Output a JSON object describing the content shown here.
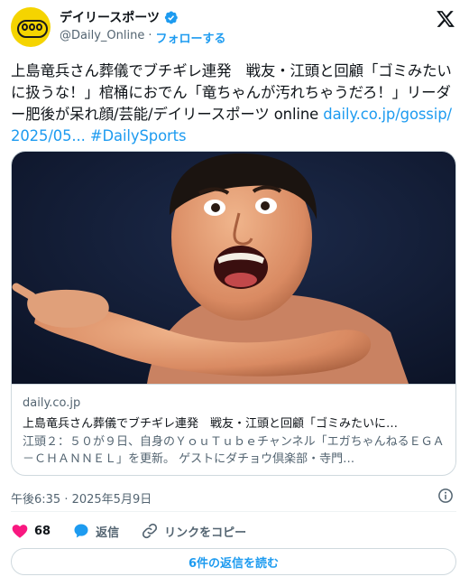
{
  "author": {
    "name": "デイリースポーツ",
    "handle": "@Daily_Online",
    "dot": "·",
    "follow_label": "フォローする",
    "avatar_icon": "daily-sports-logo",
    "verified_icon": "verified-badge-icon",
    "verified_color": "#1d9bf0"
  },
  "tweet": {
    "text": "上島竜兵さん葬儀でブチギレ連発　戦友・江頭と回顧「ゴミみたいに扱うな！」棺桶におでん「竜ちゃんが汚れちゃうだろ！」リーダー肥後が呆れ顔/芸能/デイリースポーツ online ",
    "link": "daily.co.jp/gossip/2025/05...",
    "space": " ",
    "hashtag": "#DailySports"
  },
  "card": {
    "image_subject": "photo of a shouting man pointing forward",
    "domain": "daily.co.jp",
    "title": "上島竜兵さん葬儀でブチギレ連発　戦友・江頭と回顧「ゴミみたいに…",
    "description": "江頭２：５０が９日、自身のＹｏｕＴｕｂｅチャンネル「エガちゃんねるＥＧＡ－ＣＨＡＮＮＥＬ」を更新。 ゲストにダチョウ倶楽部・寺門…"
  },
  "timestamp": "午後6:35 · 2025年5月9日",
  "actions": {
    "likes_count": "68",
    "reply_label": "返信",
    "copy_link_label": "リンクをコピー",
    "like_color": "#f91880",
    "accent_color": "#1d9bf0"
  },
  "read_replies_label": "6件の返信を読む"
}
